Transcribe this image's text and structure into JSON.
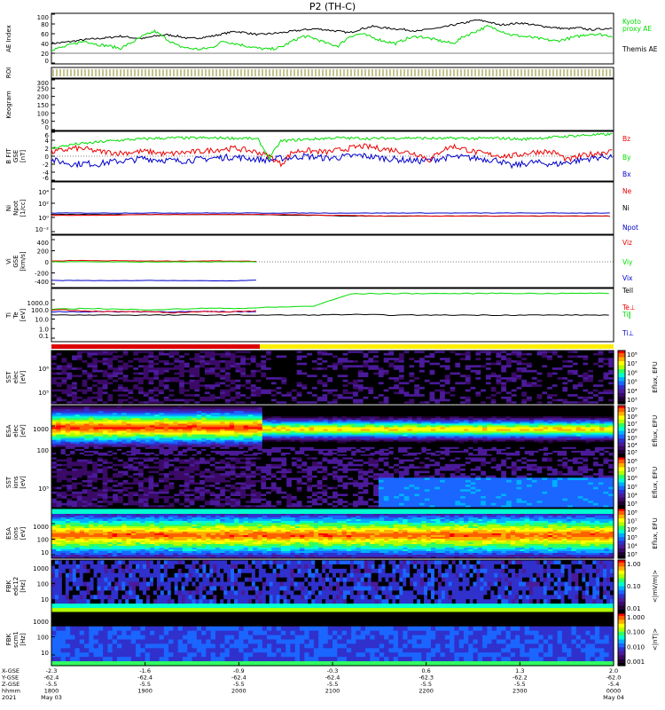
{
  "title": "P2 (TH-C)",
  "colors": {
    "green": "#00dd00",
    "red": "#ee0000",
    "blue": "#0000cc",
    "black": "#000000",
    "mode_red": "#dd0000",
    "mode_yellow": "#ffee00"
  },
  "panels": {
    "ae": {
      "ylabel": "AE Index",
      "ticks": [
        "100",
        "80",
        "60",
        "40",
        "20",
        "0"
      ],
      "legend": [
        "Kyoto",
        "proxy AE",
        "Themis AE"
      ]
    },
    "roi": {
      "ylabel": "ROI"
    },
    "keogram": {
      "ylabel": "Keogram",
      "ticks": [
        "300",
        "250",
        "200",
        "150",
        "100",
        "50",
        "0"
      ]
    },
    "bfield": {
      "ylabel": [
        "B FIT",
        "GSE",
        "[nT]"
      ],
      "ticks": [
        "6",
        "4",
        "2",
        "0",
        "-2",
        "-4",
        "-6"
      ],
      "legend": [
        "Bz",
        "By",
        "Bx"
      ]
    },
    "ni": {
      "ylabel": [
        "Ni",
        "Npot",
        "[1/cc]"
      ],
      "ticks": [
        "10⁴",
        "10²",
        "10⁰",
        "10⁻²"
      ],
      "legend": [
        "Ne",
        "Ni",
        "Npot"
      ]
    },
    "vi": {
      "ylabel": [
        "Vi",
        "GSE",
        "[km/s]"
      ],
      "ticks": [
        "400",
        "200",
        "0",
        "-200",
        "-400"
      ],
      "legend": [
        "Viz",
        "Viy",
        "Vix"
      ]
    },
    "ti": {
      "ylabel": [
        "Ti",
        "Te",
        "[eV]"
      ],
      "ticks": [
        "1000.0",
        "100.0",
        "10.0",
        "1.0",
        "0.1"
      ],
      "legend": [
        "Tell",
        "Te⊥",
        "Ti‖",
        "Ti⊥"
      ]
    },
    "sst_e": {
      "ylabel": [
        "SST",
        "elec",
        "[eV]"
      ],
      "ticks": [
        "10⁶",
        "10⁵"
      ],
      "cbar": [
        "10⁸",
        "10⁷",
        "10⁶",
        "10⁵",
        "10⁴",
        "10³"
      ],
      "cbar_label": "Eflux, EFU"
    },
    "esa_e": {
      "ylabel": [
        "ESA",
        "elec",
        "[eV]"
      ],
      "ticks": [
        "1000",
        "100"
      ],
      "cbar": [
        "10⁹",
        "10⁸",
        "10⁷",
        "10⁶",
        "10⁵",
        "10⁴",
        "10³"
      ],
      "cbar_label": "Eflux, EFU"
    },
    "sst_i": {
      "ylabel": [
        "SST",
        "ions",
        "[eV]"
      ],
      "ticks": [
        "10⁵"
      ],
      "cbar": [
        "10⁸",
        "10⁷",
        "10⁶",
        "10⁵",
        "10⁴",
        "10³"
      ],
      "cbar_label": "Eflux, EFU"
    },
    "esa_i": {
      "ylabel": [
        "ESA",
        "ions",
        "[eV]"
      ],
      "ticks": [
        "1000",
        "100",
        "10"
      ],
      "cbar": [
        "10⁸",
        "10⁷",
        "10⁶",
        "10⁵",
        "10⁴",
        "10³"
      ],
      "cbar_label": "Eflux, EFU"
    },
    "fbk_e": {
      "ylabel": [
        "FBK",
        "edc12",
        "[Hz]"
      ],
      "ticks": [
        "1000",
        "100",
        "10"
      ],
      "cbar": [
        "1.00",
        "0.10",
        "0.01"
      ],
      "cbar_label": "<|mV/m|>"
    },
    "fbk_b": {
      "ylabel": [
        "FBK",
        "scm1",
        "[Hz]"
      ],
      "ticks": [
        "1000",
        "100",
        "10"
      ],
      "cbar": [
        "1.000",
        "0.100",
        "0.010",
        "0.001"
      ],
      "cbar_label": "<|nT|>"
    }
  },
  "xaxis": {
    "row_labels": [
      "X-GSE",
      "Y-GSE",
      "Z-GSE",
      "hhmm",
      "2021"
    ],
    "ticks": [
      {
        "x": "-2.3",
        "y": "-62.4",
        "z": "-5.5",
        "hhmm": "1800",
        "date": "May 03"
      },
      {
        "x": "-1.6",
        "y": "-62.4",
        "z": "-5.5",
        "hhmm": "1900",
        "date": ""
      },
      {
        "x": "-0.9",
        "y": "-62.4",
        "z": "-5.5",
        "hhmm": "2000",
        "date": ""
      },
      {
        "x": "-0.3",
        "y": "-62.4",
        "z": "-5.5",
        "hhmm": "2100",
        "date": ""
      },
      {
        "x": "0.6",
        "y": "-62.3",
        "z": "-5.5",
        "hhmm": "2200",
        "date": ""
      },
      {
        "x": "1.3",
        "y": "-62.2",
        "z": "-5.5",
        "hhmm": "2300",
        "date": ""
      },
      {
        "x": "2.0",
        "y": "-62.0",
        "z": "-5.4",
        "hhmm": "0000",
        "date": "May 04"
      }
    ]
  },
  "chart_data": {
    "type": "line",
    "title": "P2 (TH-C)",
    "xlabel": "hhmm",
    "x_hours": [
      18,
      19,
      20,
      21,
      22,
      23,
      24
    ],
    "ae_index": {
      "ylim": [
        0,
        100
      ],
      "series": [
        {
          "name": "Themis AE",
          "color": "#000000",
          "values": [
            40,
            42,
            45,
            48,
            50,
            52,
            55,
            52,
            50,
            55,
            58,
            55,
            50,
            52,
            55,
            60,
            65,
            62,
            58,
            60,
            62,
            65,
            68,
            70,
            68,
            65,
            62,
            70,
            75,
            72,
            70,
            68,
            65,
            70,
            72,
            78,
            82,
            88,
            85,
            78,
            80,
            82,
            78,
            75,
            72,
            70,
            72,
            68,
            70,
            72
          ]
        },
        {
          "name": "Kyoto proxy AE",
          "color": "#00dd00",
          "values": [
            28,
            32,
            40,
            45,
            38,
            35,
            30,
            42,
            55,
            65,
            50,
            35,
            30,
            28,
            32,
            45,
            40,
            35,
            30,
            28,
            32,
            45,
            55,
            50,
            40,
            35,
            55,
            60,
            52,
            45,
            40,
            50,
            55,
            50,
            45,
            40,
            55,
            65,
            75,
            68,
            58,
            55,
            52,
            48,
            45,
            50,
            55,
            60,
            58,
            55
          ]
        }
      ]
    },
    "b_fit": {
      "ylim": [
        -6,
        6
      ],
      "series": [
        {
          "name": "Bz",
          "color": "#ee0000",
          "values": [
            1,
            1.5,
            2,
            1.8,
            1.2,
            1,
            0.8,
            1,
            1.2,
            1,
            0.5,
            0.8,
            1,
            1.2,
            1.5,
            1.8,
            2,
            1.5,
            1,
            0,
            -2,
            1,
            1.5,
            1.2,
            1,
            1.5,
            2,
            2.5,
            2.2,
            1.8,
            1.5,
            1,
            0.5,
            -1,
            1.5,
            2.5,
            1.8,
            1,
            0.5,
            0.2,
            0,
            0.5,
            1,
            1.2,
            0.8,
            -1,
            0,
            0.5,
            1,
            1.2
          ]
        },
        {
          "name": "By",
          "color": "#00dd00",
          "values": [
            2,
            2.5,
            3,
            3.2,
            3.5,
            3.8,
            4,
            4.2,
            4.3,
            4.5,
            4.5,
            4.6,
            4.5,
            4.6,
            4.5,
            4.6,
            4.5,
            4.5,
            4.2,
            -0.5,
            3.8,
            4,
            4.2,
            4.3,
            4.5,
            4.6,
            4.5,
            4.5,
            4.4,
            4.5,
            4.5,
            4.6,
            4.5,
            4.5,
            4.4,
            4.5,
            4.5,
            4.4,
            4.5,
            4.5,
            4.4,
            4.2,
            4.5,
            4.6,
            4.8,
            5,
            5.2,
            5.3,
            5.4,
            5.5
          ]
        },
        {
          "name": "Bx",
          "color": "#0000cc",
          "values": [
            -1,
            -1.5,
            -2,
            -1.8,
            -2,
            -1.5,
            -1.2,
            -1,
            -0.5,
            -0.8,
            -1,
            -1.2,
            -1,
            -0.8,
            -0.5,
            -0.3,
            -0.2,
            -0.5,
            -0.8,
            -1,
            -0.5,
            -0.3,
            0,
            -0.2,
            -0.5,
            -0.3,
            0,
            0.2,
            -0.2,
            -0.5,
            -0.8,
            -1,
            -1.2,
            -1,
            -0.5,
            -0.2,
            -0.3,
            -0.5,
            -0.8,
            -1,
            -2.5,
            -2,
            -1.5,
            -1.8,
            -2,
            -1.5,
            -1,
            -0.5,
            -0.2,
            0
          ]
        }
      ]
    },
    "density": {
      "ylim_log10": [
        -2,
        4
      ],
      "series": [
        {
          "name": "Ne",
          "color": "#ee0000",
          "values_log10": [
            0.2,
            0.2,
            0.2,
            0.3,
            0.3,
            0.3,
            0.3,
            0.3,
            0.3,
            0.2,
            0.2,
            0.1,
            0.1,
            0.1,
            0.1,
            0.1,
            0.1,
            0.1,
            0.1,
            0.1
          ]
        },
        {
          "name": "Ni",
          "color": "#000000",
          "values_log10": [
            0.3,
            0.3,
            0.3,
            0.3,
            0.3,
            0.3,
            0.3,
            0.3,
            0.2,
            0.2,
            0.1,
            0.1,
            0.1,
            0.1,
            0.1,
            0.1,
            0.1,
            0.1,
            0.1,
            0.1
          ]
        },
        {
          "name": "Npot",
          "color": "#0000cc",
          "values_log10": [
            0.5,
            0.5,
            0.5,
            0.5,
            0.5,
            0.5,
            0.5,
            0.5,
            0.5,
            0.5,
            0.5,
            0.5,
            0.5,
            0.5,
            0.5,
            0.5,
            0.5,
            0.5,
            0.5,
            0.5
          ]
        }
      ]
    },
    "velocity": {
      "ylim": [
        -500,
        500
      ],
      "series": [
        {
          "name": "Viz",
          "color": "#ee0000",
          "values": [
            20,
            30,
            25,
            20,
            15,
            20,
            20,
            10
          ]
        },
        {
          "name": "Viy",
          "color": "#00dd00",
          "values": [
            0,
            5,
            0,
            -5,
            0,
            0,
            0,
            0
          ]
        },
        {
          "name": "Vix",
          "color": "#0000cc",
          "values": [
            -420,
            -420,
            -425,
            -420,
            -420,
            -425,
            -430,
            -410
          ]
        }
      ]
    },
    "temperature": {
      "ylim_log10": [
        -1.3,
        3.3
      ],
      "series": [
        {
          "name": "Te⊥",
          "color": "#ee0000",
          "values_log10": [
            1.5,
            1.4,
            1.3,
            1.3,
            1.2,
            1.3,
            1.3,
            1.4
          ]
        },
        {
          "name": "Ti‖",
          "color": "#00dd00",
          "values_log10": [
            1.5,
            1.6,
            1.5,
            1.5,
            1.6,
            1.6,
            1.7,
            1.8,
            2.9,
            2.92,
            2.93,
            2.92,
            2.95,
            2.93,
            2.94,
            2.95
          ]
        },
        {
          "name": "Ti⊥",
          "color": "#0000cc",
          "values_log10": [
            1.3,
            1.3,
            1.3,
            1.3,
            1.3,
            1.3,
            1.3,
            1.3
          ]
        },
        {
          "name": "Tell",
          "color": "#000000",
          "values_log10": [
            1.0,
            1.0,
            1.0,
            1.0,
            1.0,
            1.0,
            1.0,
            1.0,
            1.05,
            1.0,
            1.0,
            1.0,
            1.0,
            1.0,
            1.0,
            1.0
          ]
        }
      ]
    }
  }
}
